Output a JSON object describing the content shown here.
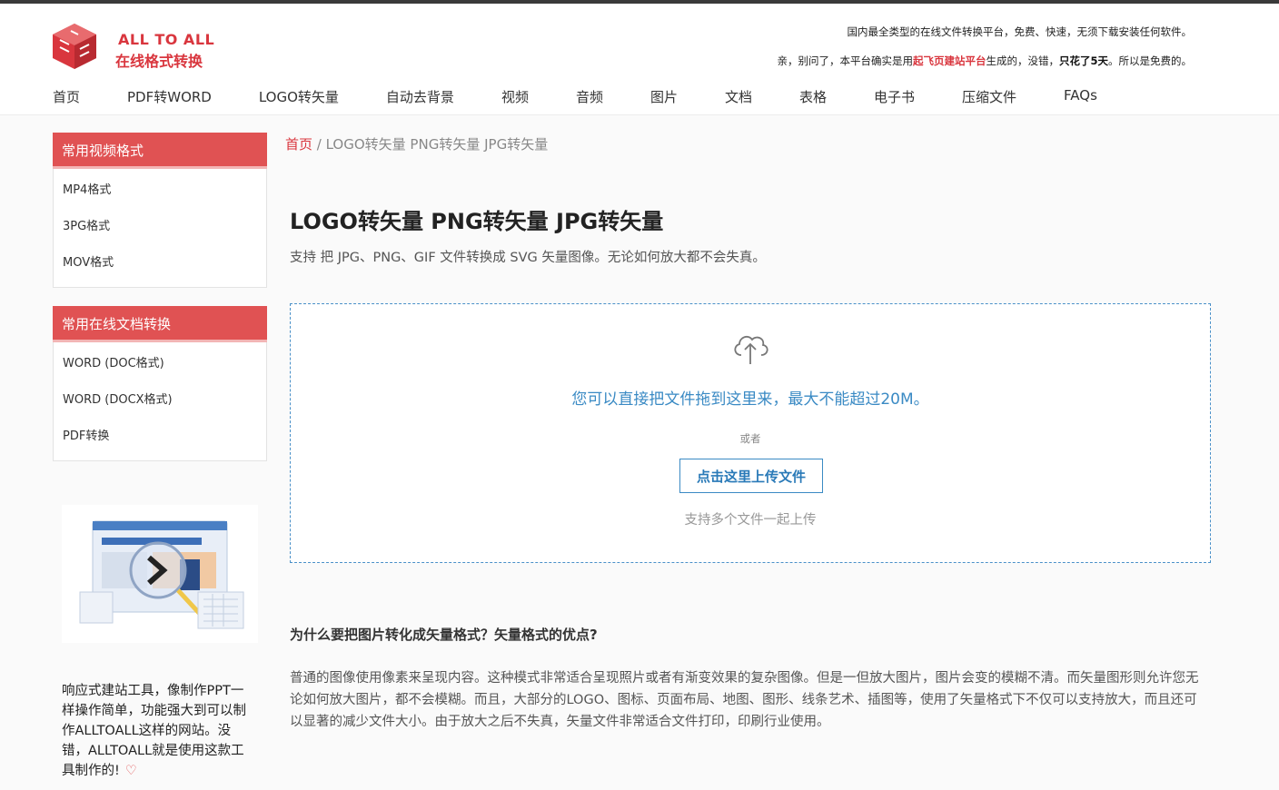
{
  "header": {
    "brand_line1": "ALL TO ALL",
    "brand_line2": "在线格式转换",
    "slogan1": "国内最全类型的在线文件转换平台，免费、快速，无须下载安装任何软件。",
    "slogan2_part1": "亲，别问了，本平台确实是用",
    "slogan2_link": "起飞页建站平台",
    "slogan2_part2": "生成的，没错，",
    "slogan2_bold": "只花了5天",
    "slogan2_part3": "。所以是免费的。"
  },
  "nav": {
    "items": [
      "首页",
      "PDF转WORD",
      "LOGO转矢量",
      "自动去背景",
      "视频",
      "音频",
      "图片",
      "文档",
      "表格",
      "电子书",
      "压缩文件",
      "FAQs"
    ]
  },
  "sidebar": {
    "video_title": "常用视频格式",
    "video_items": [
      "MP4格式",
      "3PG格式",
      "MOV格式"
    ],
    "doc_title": "常用在线文档转换",
    "doc_items": [
      "WORD (DOC格式)",
      "WORD (DOCX格式)",
      "PDF转换"
    ],
    "promo_text": "响应式建站工具，像制作PPT一样操作简单，功能强大到可以制作ALLTOALL这样的网站。没错，ALLTOALL就是使用这款工具制作的!"
  },
  "breadcrumb": {
    "home": "首页",
    "sep": " / ",
    "current": "LOGO转矢量 PNG转矢量 JPG转矢量"
  },
  "main": {
    "title": "LOGO转矢量 PNG转矢量  JPG转矢量",
    "subtitle": "支持 把 JPG、PNG、GIF 文件转换成 SVG 矢量图像。无论如何放大都不会失真。",
    "drop_text": "您可以直接把文件拖到这里来，最大不能超过20M。",
    "or_text": "或者",
    "upload_button": "点击这里上传文件",
    "multi_text": "支持多个文件一起上传",
    "section_title": "为什么要把图片转化成矢量格式？矢量格式的优点?",
    "section_body": "普通的图像使用像素来呈现内容。这种模式非常适合呈现照片或者有渐变效果的复杂图像。但是一但放大图片，图片会变的模糊不清。而矢量图形则允许您无论如何放大图片，都不会模糊。而且，大部分的LOGO、图标、页面布局、地图、图形、线条艺术、插图等，使用了矢量格式下不仅可以支持放大，而且还可以显著的减少文件大小。由于放大之后不失真，矢量文件非常适合文件打印，印刷行业使用。"
  },
  "colors": {
    "accent_red": "#d9363e",
    "sidebar_red": "#e05253",
    "link_blue": "#3a8ac4"
  }
}
